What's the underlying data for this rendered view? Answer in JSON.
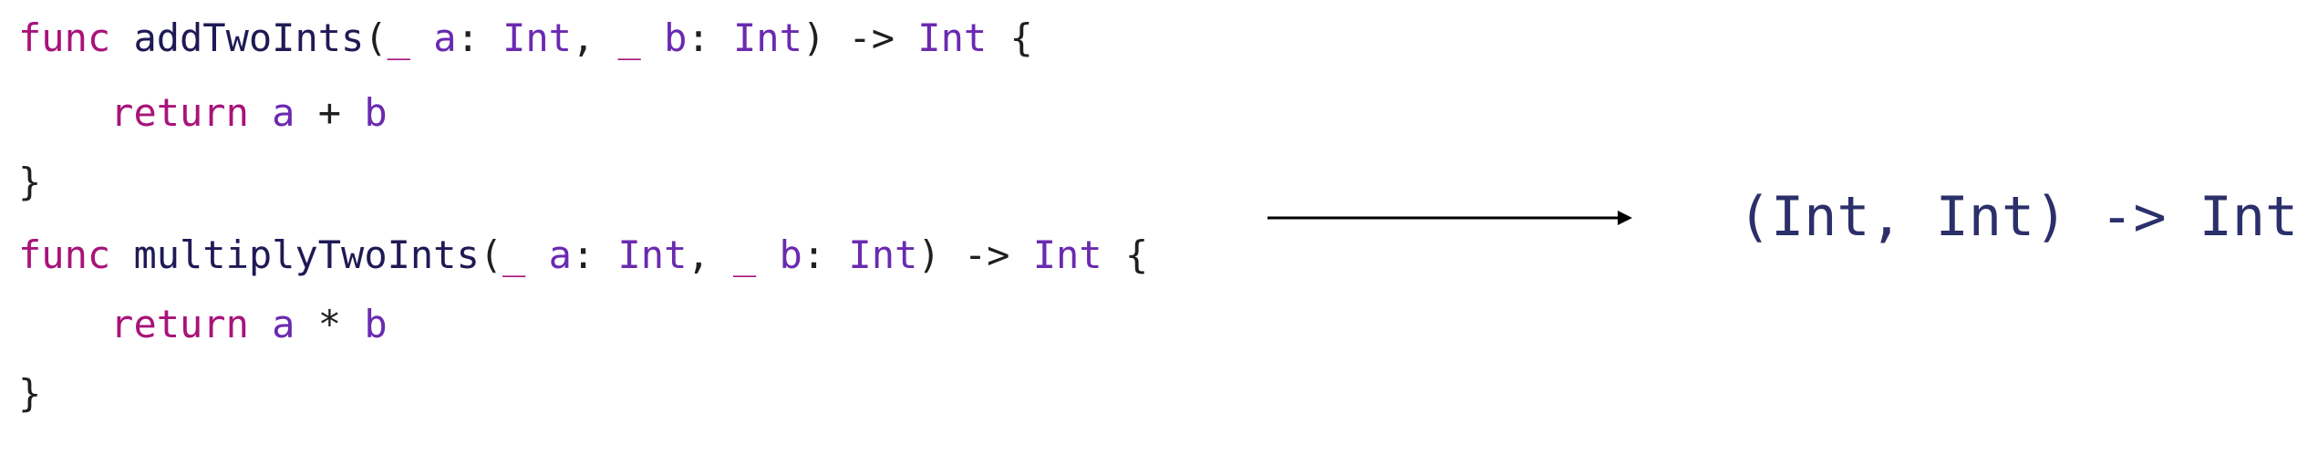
{
  "code_lines": [
    {
      "tokens": [
        {
          "t": "kw",
          "v": "func"
        },
        {
          "t": "punct",
          "v": " "
        },
        {
          "t": "name",
          "v": "addTwoInts"
        },
        {
          "t": "punct",
          "v": "("
        },
        {
          "t": "kw",
          "v": "_"
        },
        {
          "t": "punct",
          "v": " "
        },
        {
          "t": "ident",
          "v": "a"
        },
        {
          "t": "punct",
          "v": ": "
        },
        {
          "t": "type",
          "v": "Int"
        },
        {
          "t": "punct",
          "v": ", "
        },
        {
          "t": "kw",
          "v": "_"
        },
        {
          "t": "punct",
          "v": " "
        },
        {
          "t": "ident",
          "v": "b"
        },
        {
          "t": "punct",
          "v": ": "
        },
        {
          "t": "type",
          "v": "Int"
        },
        {
          "t": "punct",
          "v": ") -> "
        },
        {
          "t": "type",
          "v": "Int"
        },
        {
          "t": "punct",
          "v": " {"
        }
      ]
    },
    {
      "indent": "    ",
      "tokens": [
        {
          "t": "kw",
          "v": "return"
        },
        {
          "t": "punct",
          "v": " "
        },
        {
          "t": "ident",
          "v": "a"
        },
        {
          "t": "punct",
          "v": " + "
        },
        {
          "t": "ident",
          "v": "b"
        }
      ]
    },
    {
      "tokens": [
        {
          "t": "brace",
          "v": "}"
        }
      ]
    },
    {
      "tokens": [
        {
          "t": "kw",
          "v": "func"
        },
        {
          "t": "punct",
          "v": " "
        },
        {
          "t": "name",
          "v": "multiplyTwoInts"
        },
        {
          "t": "punct",
          "v": "("
        },
        {
          "t": "kw",
          "v": "_"
        },
        {
          "t": "punct",
          "v": " "
        },
        {
          "t": "ident",
          "v": "a"
        },
        {
          "t": "punct",
          "v": ": "
        },
        {
          "t": "type",
          "v": "Int"
        },
        {
          "t": "punct",
          "v": ", "
        },
        {
          "t": "kw",
          "v": "_"
        },
        {
          "t": "punct",
          "v": " "
        },
        {
          "t": "ident",
          "v": "b"
        },
        {
          "t": "punct",
          "v": ": "
        },
        {
          "t": "type",
          "v": "Int"
        },
        {
          "t": "punct",
          "v": ") -> "
        },
        {
          "t": "type",
          "v": "Int"
        },
        {
          "t": "punct",
          "v": " {"
        }
      ]
    },
    {
      "indent": "    ",
      "tokens": [
        {
          "t": "kw",
          "v": "return"
        },
        {
          "t": "punct",
          "v": " "
        },
        {
          "t": "ident",
          "v": "a"
        },
        {
          "t": "punct",
          "v": " * "
        },
        {
          "t": "ident",
          "v": "b"
        }
      ]
    },
    {
      "tokens": [
        {
          "t": "brace",
          "v": "}"
        }
      ]
    }
  ],
  "result_type": "(Int, Int) -> Int",
  "colors": {
    "keyword": "#a8137a",
    "function_name": "#1f1a55",
    "type": "#6a2ab0",
    "text": "#1f1f1f",
    "result": "#2b2f6a",
    "arrow": "#000000"
  }
}
